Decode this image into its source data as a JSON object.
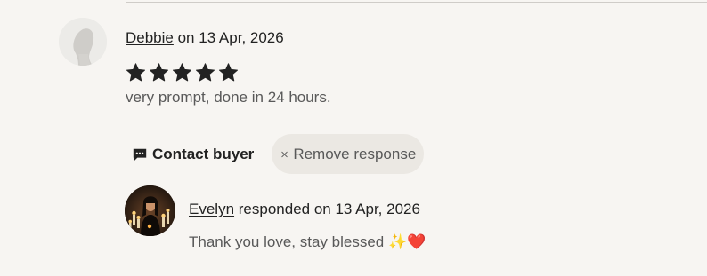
{
  "review": {
    "reviewer_name": "Debbie",
    "date_prefix": " on ",
    "date": "13 Apr, 2026",
    "rating": 5,
    "rating_max": 5,
    "text": "very prompt, done in 24 hours."
  },
  "actions": {
    "contact_label": "Contact buyer",
    "remove_label": "Remove response"
  },
  "response": {
    "responder_name": "Evelyn",
    "responded_prefix": " responded on ",
    "date": "13 Apr, 2026",
    "text": "Thank you love, stay blessed ✨❤️"
  },
  "icons": {
    "reviewer_avatar": "default-user-avatar-icon",
    "star": "star-icon",
    "contact": "message-bubble-icon",
    "remove": "close-icon"
  },
  "colors": {
    "background": "#f7f5f2",
    "text_primary": "#222222",
    "text_secondary": "#595959",
    "star": "#222222",
    "remove_button_bg": "#ebe8e3"
  }
}
